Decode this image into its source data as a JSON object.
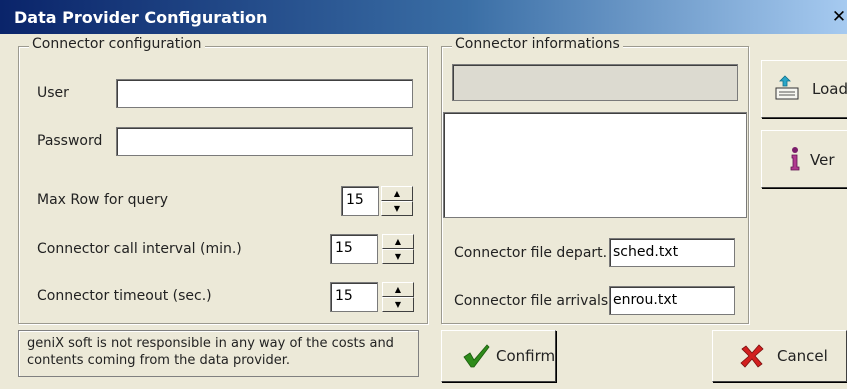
{
  "window": {
    "title": "Data Provider Configuration",
    "close_glyph": "✕"
  },
  "connector_config": {
    "legend": "Connector configuration",
    "user_label": "User",
    "user_value": "",
    "password_label": "Password",
    "password_value": "",
    "max_row_label": "Max Row for query",
    "max_row_value": "15",
    "interval_label": "Connector call interval (min.)",
    "interval_value": "15",
    "timeout_label": "Connector timeout (sec.)",
    "timeout_value": "15"
  },
  "connector_info": {
    "legend": "Connector informations",
    "info_value": "",
    "memo_value": "",
    "depart_label": "Connector file depart.",
    "depart_value": "sched.txt",
    "arrivals_label": "Connector file arrivals",
    "arrivals_value": "enrou.txt"
  },
  "buttons": {
    "load": "Load",
    "ver": "Ver",
    "confirm": "Confirm",
    "cancel": "Cancel"
  },
  "disclaimer": {
    "line1": "geniX soft is not responsible in any way of the costs and",
    "line2": "contents coming from the data provider."
  },
  "icons": {
    "load": "keyboard-upload-icon",
    "ver": "info-icon",
    "confirm": "checkmark-icon",
    "cancel": "cross-icon"
  },
  "colors": {
    "accent": "#0a246a",
    "confirm_green": "#2e8b1a",
    "cancel_red": "#d21f1f"
  }
}
